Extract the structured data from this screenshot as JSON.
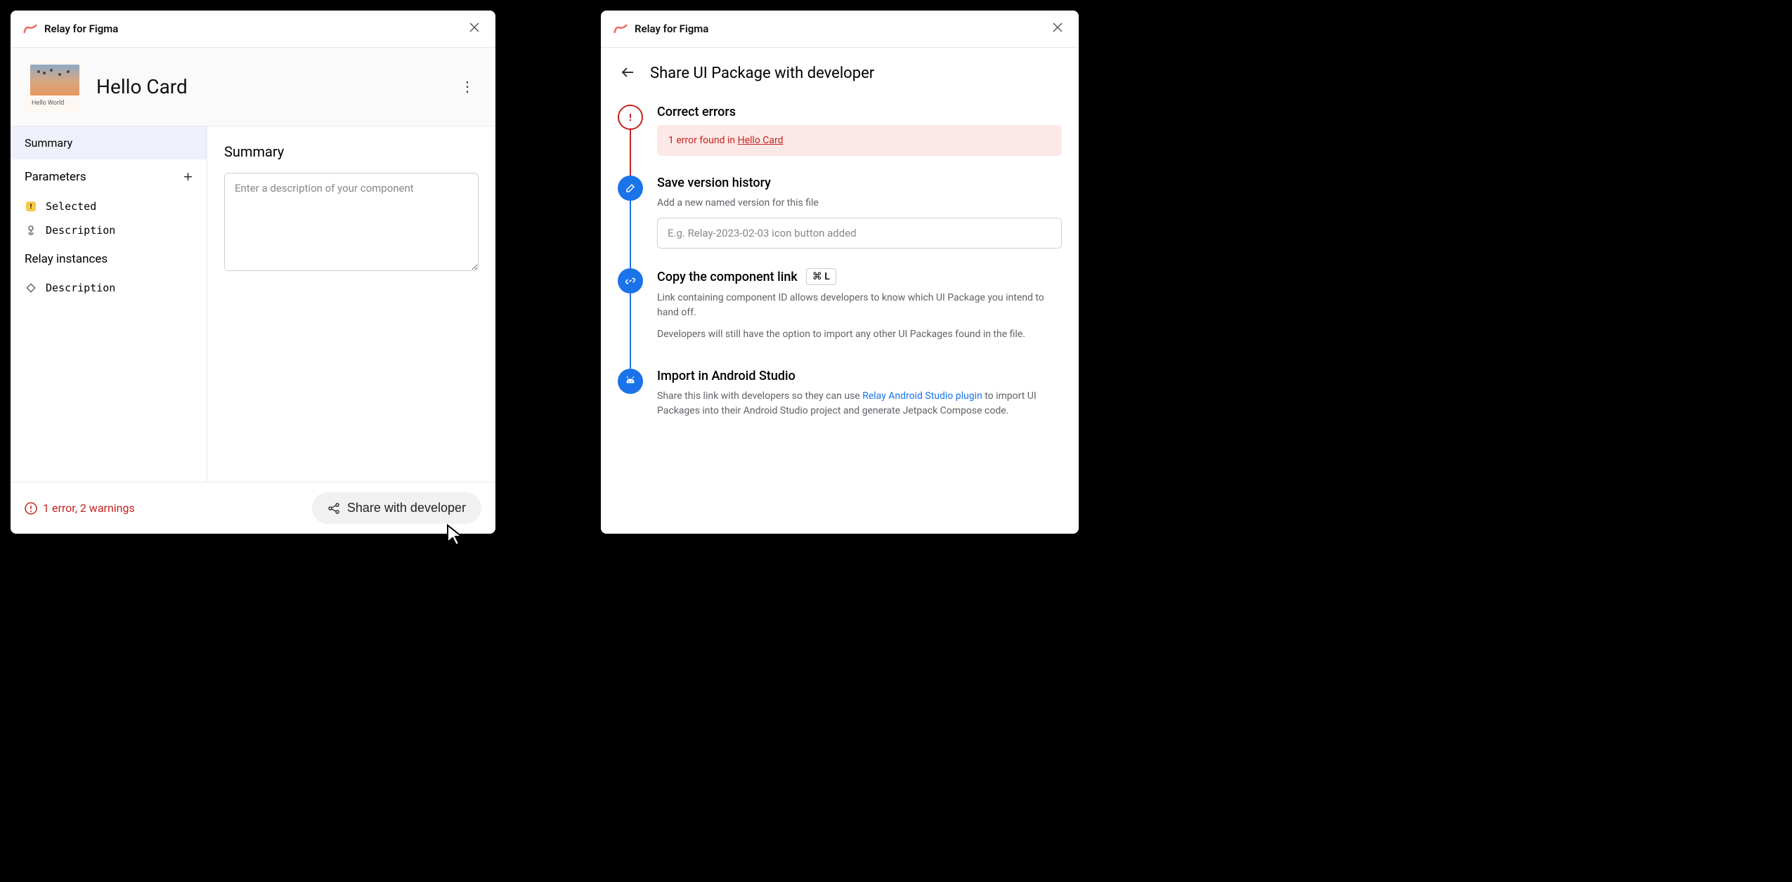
{
  "app": {
    "title": "Relay for Figma"
  },
  "window1": {
    "component_name": "Hello Card",
    "thumb_label": "Hello World",
    "sidebar": {
      "summary_label": "Summary",
      "parameters_label": "Parameters",
      "param_items": [
        {
          "label": "Selected",
          "warning": true
        },
        {
          "label": "Description",
          "icon": "touch"
        }
      ],
      "instances_label": "Relay instances",
      "instance_items": [
        {
          "label": "Description",
          "icon": "diamond"
        }
      ]
    },
    "main": {
      "heading": "Summary",
      "description_placeholder": "Enter a description of your component"
    },
    "footer": {
      "error_text": "1 error, 2 warnings",
      "share_label": "Share with developer"
    }
  },
  "window2": {
    "page_title": "Share UI Package with developer",
    "steps": {
      "correct_errors": {
        "title": "Correct errors",
        "banner_prefix": "1 error found in ",
        "banner_link": "Hello Card"
      },
      "save_version": {
        "title": "Save version history",
        "desc": "Add a new named version for this file",
        "placeholder": "E.g. Relay-2023-02-03 icon button added"
      },
      "copy_link": {
        "title": "Copy the component link",
        "shortcut": "⌘ L",
        "desc1": "Link containing component ID allows developers to know which UI Package you intend to hand off.",
        "desc2": "Developers will still have the option to import any other UI Packages found in the file."
      },
      "import": {
        "title": "Import in Android Studio",
        "desc_pre": "Share this link with developers so they can use ",
        "desc_link": "Relay Android Studio plugin",
        "desc_post": " to import UI Packages into their Android Studio project and generate Jetpack Compose code."
      }
    }
  }
}
